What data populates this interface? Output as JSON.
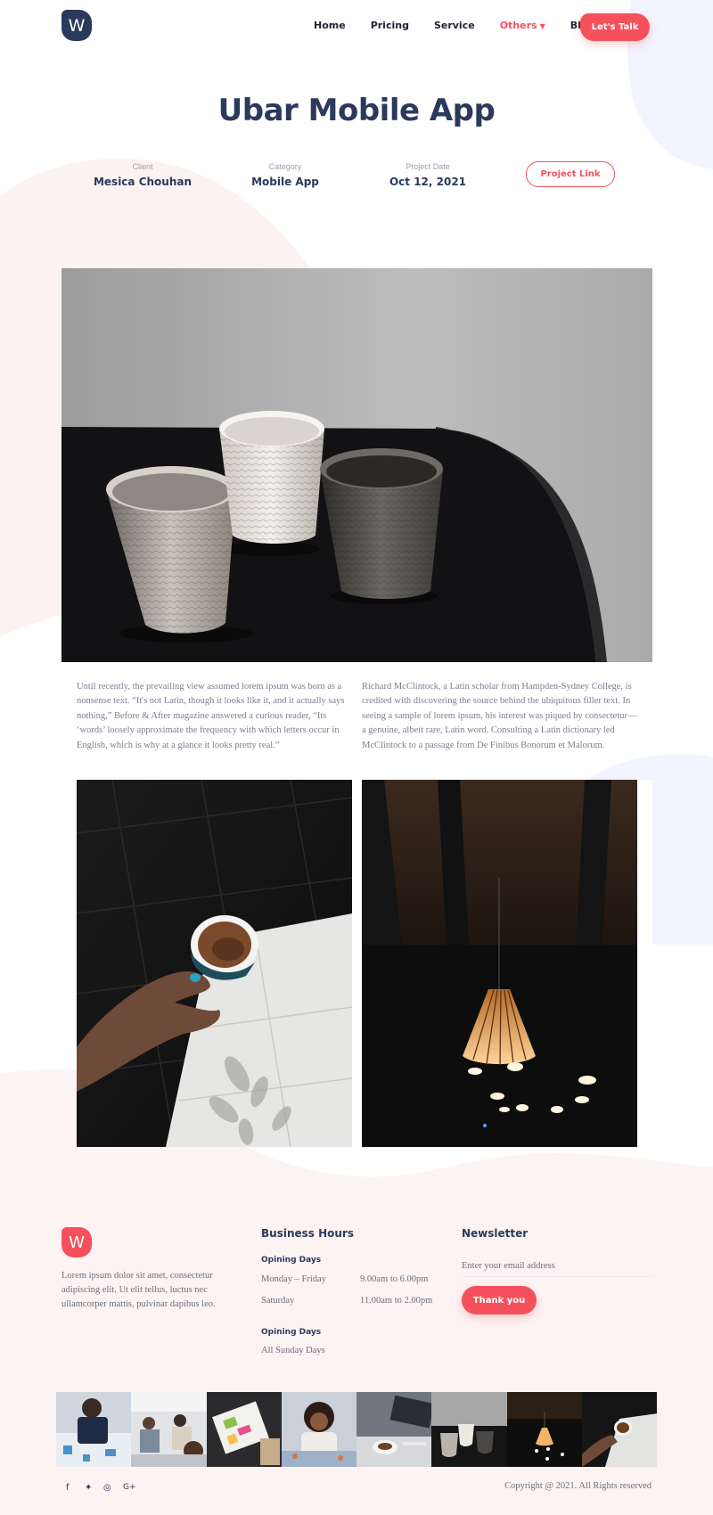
{
  "brand": {
    "logo_letter": "W",
    "accent_color": "#f5505b",
    "navy_color": "#2b3a5c"
  },
  "nav": {
    "items": [
      {
        "label": "Home",
        "active": false
      },
      {
        "label": "Pricing",
        "active": false
      },
      {
        "label": "Service",
        "active": false
      },
      {
        "label": "Others",
        "active": true,
        "has_dropdown": true
      },
      {
        "label": "Blog",
        "active": false
      }
    ],
    "cta_label": "Let's Talk"
  },
  "project": {
    "title": "Ubar Mobile App",
    "meta": [
      {
        "label": "Client",
        "value": "Mesica Chouhan"
      },
      {
        "label": "Category",
        "value": "Mobile App"
      },
      {
        "label": "Project Date",
        "value": "Oct 12, 2021"
      }
    ],
    "link_label": "Project Link"
  },
  "content": {
    "paragraph_left": "Until recently, the prevailing view assumed lorem ipsum was born as a nonsense text. “It's not Latin, though it looks like it, and it actually says nothing,” Before & After magazine answered a curious reader, “Its ‘words’ loosely approximate the frequency with which letters occur in English, which is why at a glance it looks pretty real.”",
    "paragraph_right": "Richard McClintock, a Latin scholar from Hampden-Sydney College, is credited with discovering the source behind the ubiquitous filler text. In seeing a sample of lorem ipsum, his interest was piqued by consectetur—a genuine, albeit rare, Latin word. Consulting a Latin dictionary led McClintock to a passage from De Finibus Bonorum et Malorum."
  },
  "footer": {
    "logo_letter": "W",
    "about": "Lorem ipsum dolor sit amet, consectetur adipiscing elit. Ut elit tellus, luctus nec ullamcorper mattis, pulvinar dapibus leo.",
    "hours": {
      "title": "Business Hours",
      "group1_title": "Opining Days",
      "rows": [
        {
          "day": "Monday – Friday",
          "time": "9.00am to 6.00pm"
        },
        {
          "day": "Saturday",
          "time": "11.00am to 2.00pm"
        }
      ],
      "group2_title": "Opining Days",
      "group2_text": "All Sunday Days"
    },
    "newsletter": {
      "title": "Newsletter",
      "email_placeholder": "Enter your email address",
      "button_label": "Thank you"
    },
    "social_icons": [
      "facebook-icon",
      "twitter-icon",
      "instagram-icon",
      "google-plus-icon"
    ],
    "social_glyphs": [
      "f",
      "✦",
      "◎",
      "G+"
    ],
    "copyright": "Copyright @ 2021. All Rights reserved"
  }
}
